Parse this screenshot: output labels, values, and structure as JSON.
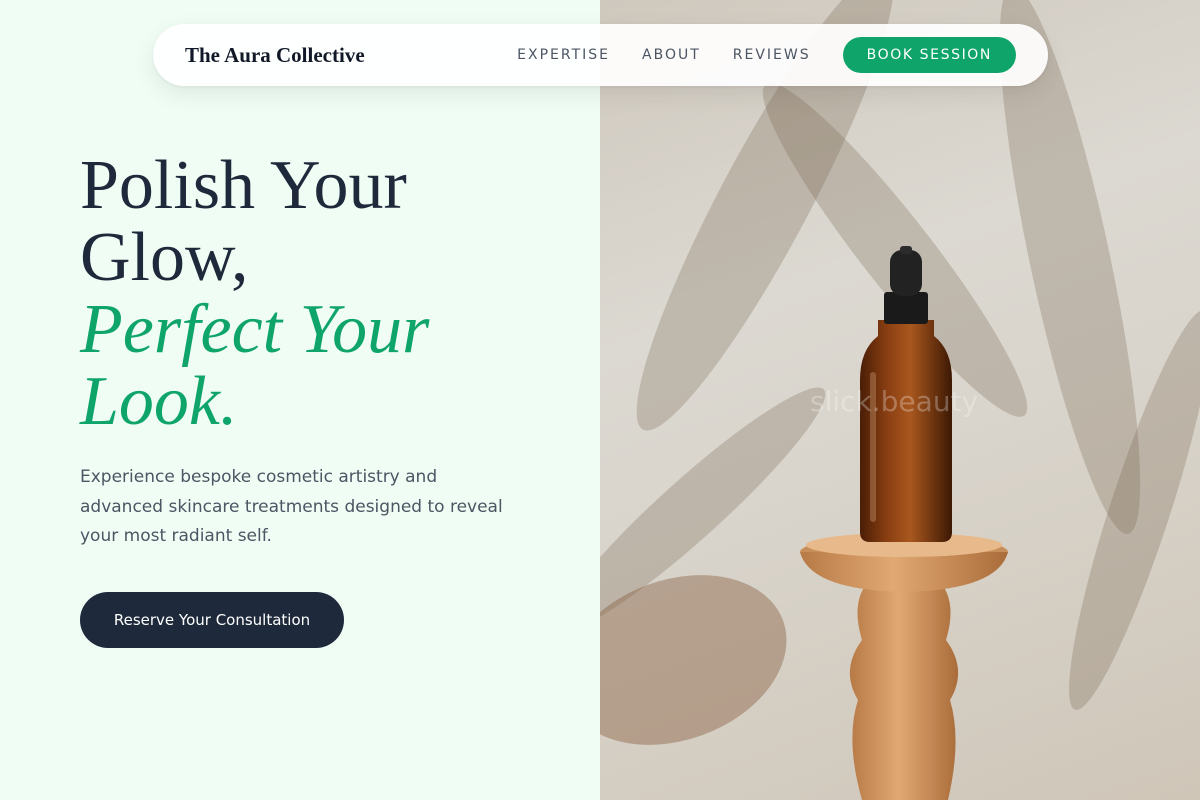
{
  "brand": {
    "name": "The Aura Collective"
  },
  "nav": {
    "links": [
      "EXPERTISE",
      "ABOUT",
      "REVIEWS"
    ],
    "cta": "BOOK SESSION"
  },
  "hero": {
    "title_line1": "Polish Your",
    "title_line2": "Glow,",
    "title_accent1": "Perfect Your",
    "title_accent2": "Look.",
    "subtitle": "Experience bespoke cosmetic artistry and advanced skincare treatments designed to reveal your most radiant self.",
    "cta": "Reserve Your Consultation"
  },
  "image": {
    "watermark": "slick.beauty"
  },
  "colors": {
    "accent": "#0fa56a",
    "dark": "#1e293b",
    "background": "#f0fdf4"
  }
}
